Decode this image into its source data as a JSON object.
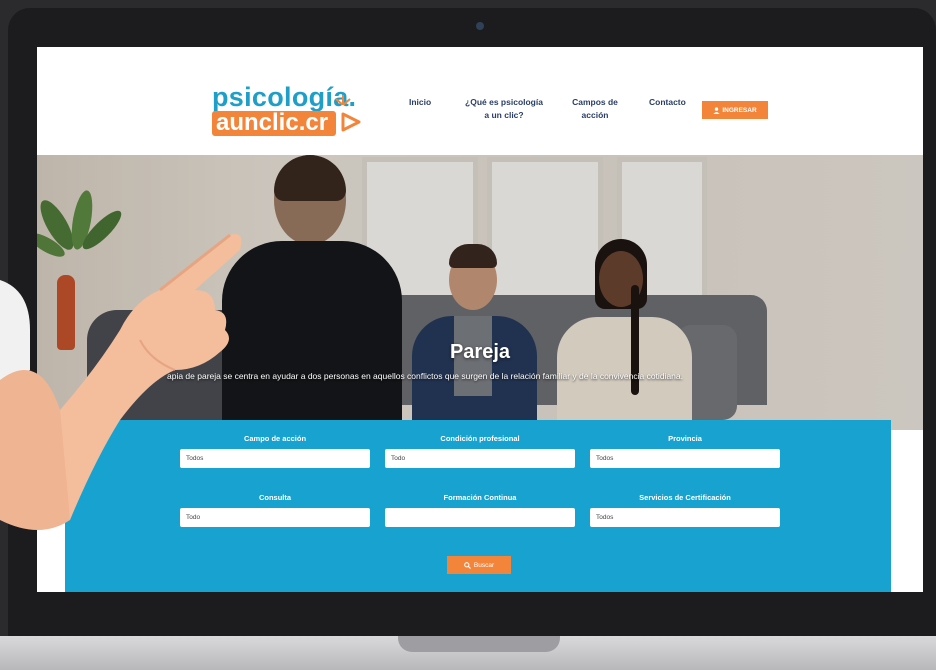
{
  "site": {
    "logo_top": "psicología.",
    "logo_bottom": "aunclic.cr"
  },
  "nav": {
    "items": [
      {
        "label_line1": "Inicio",
        "label_line2": ""
      },
      {
        "label_line1": "¿Qué es psicología",
        "label_line2": "a un clic?"
      },
      {
        "label_line1": "Campos de",
        "label_line2": "acción"
      },
      {
        "label_line1": "Contacto",
        "label_line2": ""
      }
    ],
    "login_label": "INGRESAR",
    "login_icon": "user-icon"
  },
  "hero": {
    "title": "Pareja",
    "text": "apia de pareja se centra en ayudar a dos personas en aquellos conflictos que surgen de la relación familiar y de la convivencia cotidiana."
  },
  "search": {
    "fields": [
      {
        "label": "Campo de acción",
        "value": "Todos"
      },
      {
        "label": "Condición profesional",
        "value": "Todo"
      },
      {
        "label": "Provincia",
        "value": "Todos"
      },
      {
        "label": "Consulta",
        "value": "Todo"
      },
      {
        "label": "Formación Continua",
        "value": ""
      },
      {
        "label": "Servicios de Certificación",
        "value": "Todos"
      }
    ],
    "button_label": "Buscar",
    "button_icon": "search-icon"
  },
  "colors": {
    "brand_blue": "#1f9fc8",
    "brand_orange": "#f2853a",
    "panel_blue": "#17a2cf",
    "nav_text": "#2a3d66"
  }
}
